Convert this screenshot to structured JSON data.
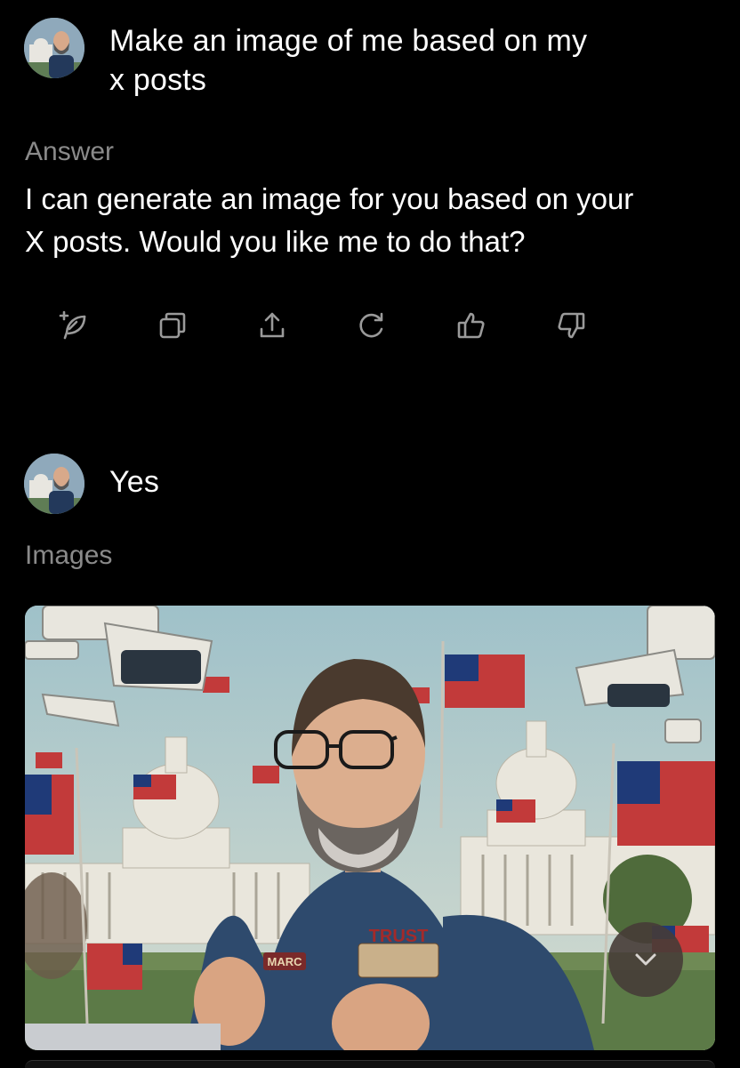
{
  "conversation": {
    "first_prompt": {
      "text_line1": "Make an image of me based on my",
      "text_line2": "x posts"
    },
    "answer": {
      "label": "Answer",
      "text_line1": "I can generate an image for you based on your",
      "text_line2": "X posts. Would you like me to do that?"
    },
    "actions": [
      {
        "icon": "new-chat-feather-icon"
      },
      {
        "icon": "copy-icon"
      },
      {
        "icon": "share-icon"
      },
      {
        "icon": "regenerate-icon"
      },
      {
        "icon": "thumbs-up-icon"
      },
      {
        "icon": "thumbs-down-icon"
      }
    ],
    "second_prompt": {
      "text": "Yes"
    },
    "images": {
      "label": "Images",
      "shirt_patch_text": "TRUST",
      "name_tag_text": "MARC"
    }
  },
  "colors": {
    "background": "#000000",
    "label_gray": "#8a8a8a",
    "icon_gray": "#9a9a9a"
  }
}
